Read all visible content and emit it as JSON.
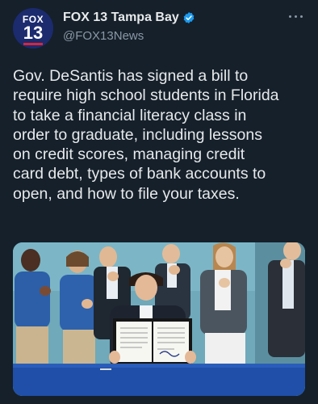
{
  "account": {
    "display_name": "FOX 13 Tampa Bay",
    "handle": "@FOX13News",
    "avatar_line1": "FOX",
    "avatar_line2": "13",
    "verified": true
  },
  "tweet": {
    "text": "Gov. DeSantis has signed a bill to\nrequire high school students in Florida\nto take a financial literacy class in\norder to graduate, including lessons\non credit scores, managing credit\ncard debt, types of bank accounts to\nopen, and how to file your taxes."
  },
  "icons": {
    "verified": "verified-badge-icon",
    "more": "more-options-icon"
  },
  "colors": {
    "background": "#15202b",
    "text": "#e7e9ea",
    "secondary": "#8b98a5",
    "verified": "#1d9bf0",
    "avatar_bg": "#1c2b6e",
    "avatar_accent": "#d7263d"
  }
}
